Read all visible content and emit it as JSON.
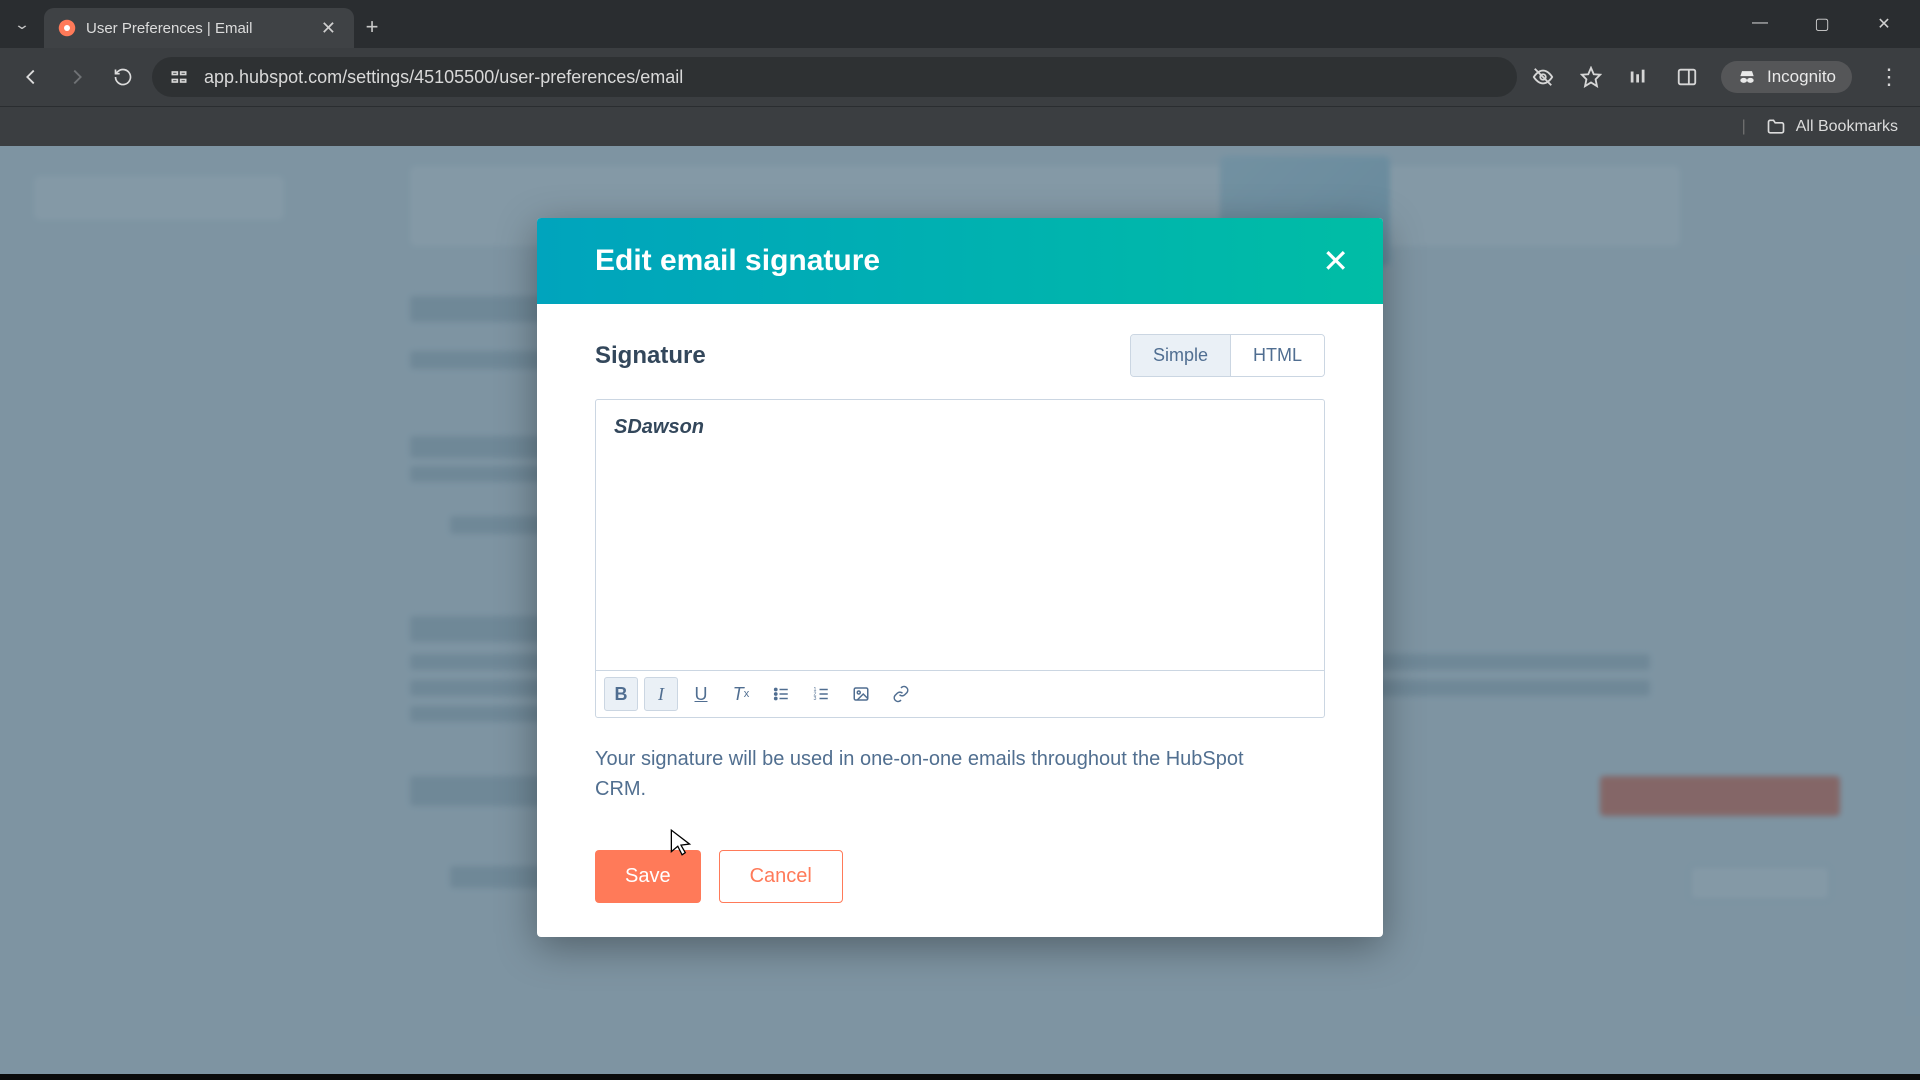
{
  "browser": {
    "tab_title": "User Preferences | Email",
    "url": "app.hubspot.com/settings/45105500/user-preferences/email",
    "incognito_label": "Incognito",
    "all_bookmarks": "All Bookmarks"
  },
  "modal": {
    "title": "Edit email signature",
    "section_label": "Signature",
    "tabs": {
      "simple": "Simple",
      "html": "HTML",
      "active": "simple"
    },
    "signature_value": "SDawson",
    "toolbar": {
      "bold": "B",
      "italic": "I",
      "underline": "U",
      "clear_format": "Tx",
      "bullets": "bulleted-list",
      "numbers": "numbered-list",
      "image": "image",
      "link": "link",
      "active": [
        "bold",
        "italic"
      ]
    },
    "help_text": "Your signature will be used in one-on-one emails throughout the HubSpot CRM.",
    "save_label": "Save",
    "cancel_label": "Cancel"
  }
}
